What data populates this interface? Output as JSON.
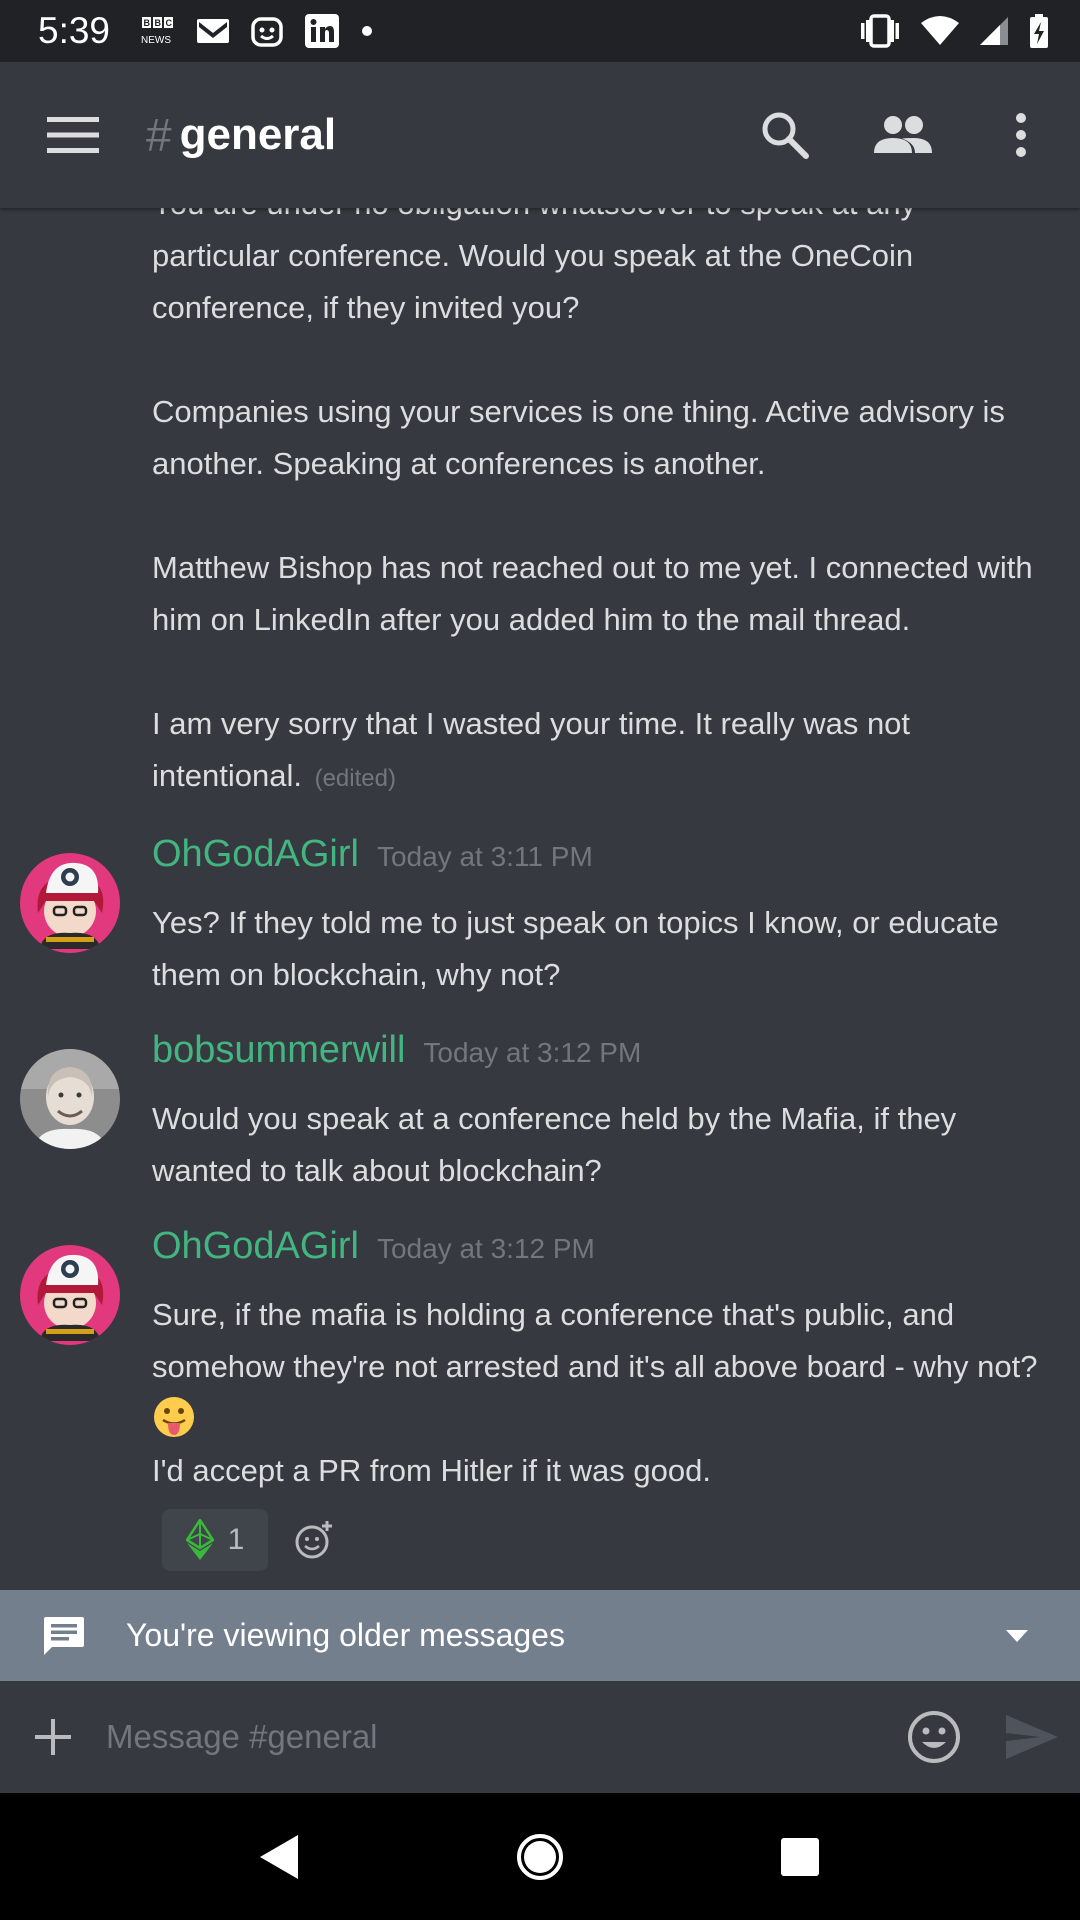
{
  "status_bar": {
    "time": "5:39",
    "left_icons": [
      "bbc-news-icon",
      "gmail-icon",
      "bot-face-icon",
      "linkedin-icon",
      "dot-icon"
    ],
    "right_icons": [
      "vibrate-icon",
      "wifi-icon",
      "cell-signal-icon",
      "battery-charging-icon"
    ],
    "bbc_label_top": "BBC",
    "bbc_label_bottom": "NEWS"
  },
  "app_bar": {
    "hash": "#",
    "channel_name": "general",
    "icons": [
      "menu-icon",
      "search-icon",
      "members-icon",
      "overflow-menu-icon"
    ]
  },
  "continued_message": {
    "paragraphs": [
      "You are under no obligation whatsoever to speak at any particular conference.  Would you speak at the OneCoin conference, if they invited you?",
      "Companies using your services is one thing.   Active advisory is another.   Speaking at conferences is another.",
      "Matthew Bishop has not reached out to me yet.   I connected with him on LinkedIn after you added him to the mail thread.",
      "I am very sorry that I wasted your time.  It really was not intentional."
    ],
    "edited_label": "(edited)"
  },
  "messages": [
    {
      "username": "OhGodAGirl",
      "username_color": "#43b581",
      "timestamp": "Today at 3:11 PM",
      "avatar": "anime-girl-avatar",
      "lines": [
        "Yes? If they told me to just speak on topics I know, or educate them on blockchain, why not?"
      ]
    },
    {
      "username": "bobsummerwill",
      "username_color": "#43b581",
      "timestamp": "Today at 3:12 PM",
      "avatar": "bald-man-photo-avatar",
      "lines": [
        "Would you speak at a conference held by the Mafia, if they wanted to talk about blockchain?"
      ]
    },
    {
      "username": "OhGodAGirl",
      "username_color": "#43b581",
      "timestamp": "Today at 3:12 PM",
      "avatar": "anime-girl-avatar",
      "lines": [
        "Sure, if the mafia is holding a conference that's public, and somehow they're not arrested and it's all above board - why not?",
        "I'd accept a PR from Hitler if it was good."
      ],
      "inline_emoji": "tongue-out-emoji",
      "reaction": {
        "icon": "ethereum-classic-icon",
        "count": "1"
      }
    }
  ],
  "older_bar": {
    "icon": "message-icon",
    "text": "You're viewing older messages",
    "caret": "caret-down-icon"
  },
  "composer": {
    "placeholder": "Message #general",
    "icons": [
      "plus-icon",
      "emoji-icon",
      "send-icon"
    ]
  },
  "nav_bar": {
    "icons": [
      "back-icon",
      "home-icon",
      "recents-icon"
    ]
  },
  "colors": {
    "background": "#36393f",
    "status_bar": "#202225",
    "username_green": "#43b581",
    "older_bar": "#747f8d",
    "muted_text": "#72767d"
  }
}
